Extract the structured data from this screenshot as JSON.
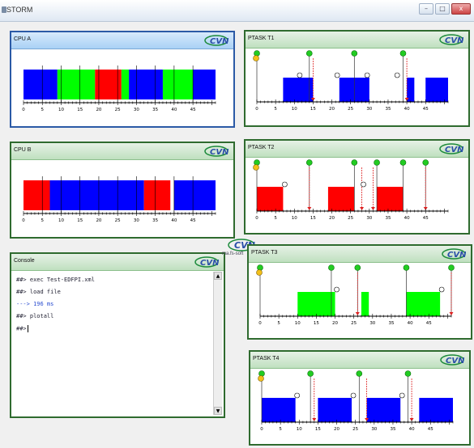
{
  "window": {
    "title": "STORM",
    "min": "–",
    "max": "□",
    "close": "x"
  },
  "logo_text": "CVN",
  "float_url": "ma.fs-soft",
  "ticks": [
    "0",
    "5",
    "10",
    "15",
    "20",
    "25",
    "30",
    "35",
    "40",
    "45"
  ],
  "cpuA": {
    "title": "CPU A",
    "segments": [
      {
        "start": 0,
        "end": 9,
        "color": "#0000ff"
      },
      {
        "start": 9,
        "end": 19,
        "color": "#00ff00"
      },
      {
        "start": 19,
        "end": 26,
        "color": "#ff0000"
      },
      {
        "start": 26,
        "end": 28,
        "color": "#00ff00"
      },
      {
        "start": 28,
        "end": 37,
        "color": "#0000ff"
      },
      {
        "start": 37,
        "end": 45,
        "color": "#00ff00"
      },
      {
        "start": 45,
        "end": 51,
        "color": "#0000ff"
      }
    ],
    "dividers": [
      5,
      10,
      15,
      20,
      25,
      30,
      35,
      40,
      45
    ]
  },
  "cpuB": {
    "title": "CPU B",
    "segments": [
      {
        "start": 0,
        "end": 7,
        "color": "#ff0000"
      },
      {
        "start": 7,
        "end": 32,
        "color": "#0000ff"
      },
      {
        "start": 32,
        "end": 39,
        "color": "#ff0000"
      },
      {
        "start": 40,
        "end": 51,
        "color": "#0000ff"
      }
    ],
    "dividers": [
      5,
      10,
      15,
      20,
      25,
      30,
      35,
      40,
      45
    ]
  },
  "ptasks": [
    {
      "title": "PTASK T1",
      "color": "#0000ff",
      "blocks": [
        [
          7,
          15
        ],
        [
          22,
          30
        ],
        [
          40,
          42
        ],
        [
          45,
          51
        ]
      ],
      "arrivals": [
        0,
        14,
        26,
        39
      ],
      "deadlines": [
        15,
        40
      ],
      "released": [
        11,
        21,
        29,
        37
      ]
    },
    {
      "title": "PTASK T2",
      "color": "#ff0000",
      "blocks": [
        [
          0,
          7
        ],
        [
          19,
          26
        ],
        [
          32,
          39
        ]
      ],
      "arrivals": [
        0,
        14,
        26,
        32,
        39,
        45
      ],
      "deadlines": [
        14,
        28,
        31,
        45
      ],
      "released": [
        7,
        28
      ]
    },
    {
      "title": "PTASK T3",
      "color": "#00ff00",
      "blocks": [
        [
          10,
          20
        ],
        [
          27,
          29
        ],
        [
          39,
          48
        ]
      ],
      "arrivals": [
        0,
        19,
        26,
        39,
        51
      ],
      "deadlines": [
        26,
        51
      ],
      "released": [
        20,
        48
      ]
    },
    {
      "title": "PTASK T4",
      "color": "#0000ff",
      "blocks": [
        [
          0,
          9
        ],
        [
          15,
          24
        ],
        [
          28,
          37
        ],
        [
          42,
          51
        ]
      ],
      "arrivals": [
        0,
        13,
        26,
        39
      ],
      "deadlines": [
        14,
        28,
        40
      ],
      "released": [
        9,
        24,
        37
      ]
    }
  ],
  "console": {
    "title": "Console",
    "lines": [
      {
        "text": "##> exec Test-EDFPI.xml",
        "type": "cmd"
      },
      {
        "text": "##> load file",
        "type": "cmd"
      },
      {
        "text": "---> 196 ms",
        "type": "out"
      },
      {
        "text": "##> plotall",
        "type": "cmd"
      },
      {
        "text": "##>",
        "type": "cmd"
      }
    ]
  }
}
